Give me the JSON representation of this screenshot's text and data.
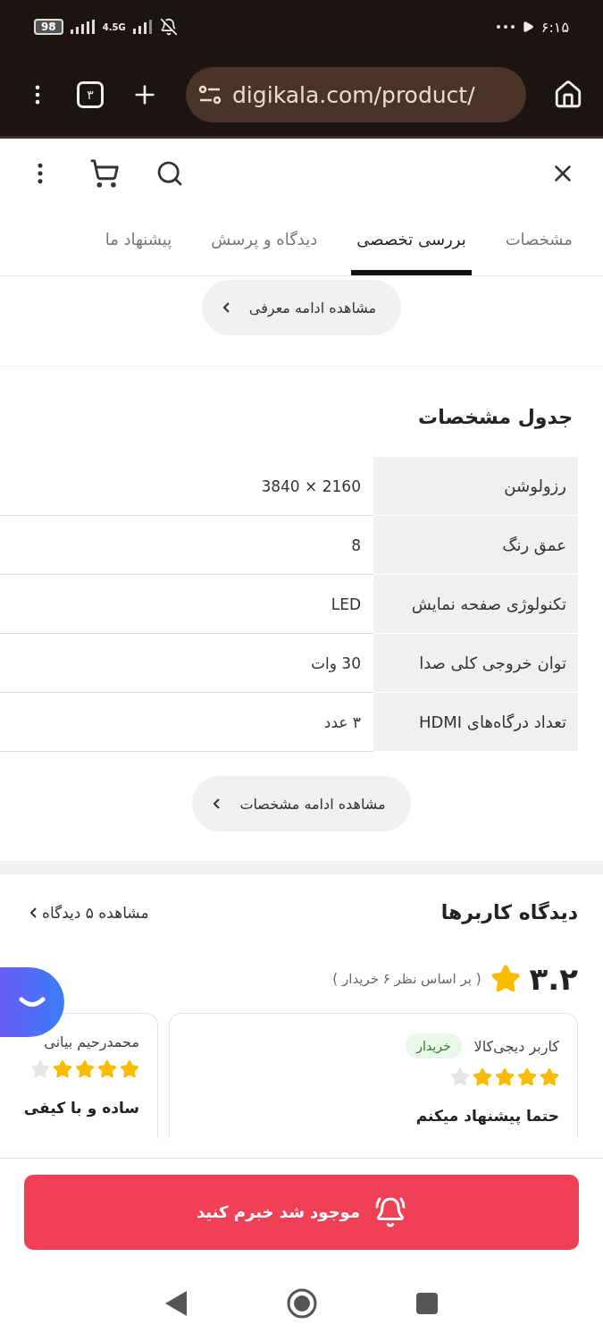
{
  "status_bar": {
    "battery": "98",
    "network": "4.5G",
    "time": "۶:۱۵"
  },
  "browser": {
    "tab_count": "۳",
    "url": "digikala.com/product/"
  },
  "tabs": [
    {
      "label": "مشخصات",
      "selected": false
    },
    {
      "label": "بررسی تخصصی",
      "selected": true
    },
    {
      "label": "دیدگاه و پرسش",
      "selected": false
    },
    {
      "label": "پیشنهاد ما",
      "selected": false
    }
  ],
  "intro_button": "مشاهده ادامه معرفی",
  "specs": {
    "title": "جدول مشخصات",
    "rows": [
      {
        "label": "رزولوشن",
        "value": "3840 × 2160"
      },
      {
        "label": "عمق رنگ",
        "value": "8"
      },
      {
        "label": "تکنولوژی صفحه نمایش",
        "value": "LED"
      },
      {
        "label": "توان خروجی کلی صدا",
        "value": "30 وات"
      },
      {
        "label": "تعداد درگاه‌های HDMI",
        "value": "۳ عدد"
      }
    ],
    "more_button": "مشاهده ادامه مشخصات"
  },
  "reviews": {
    "title": "دیدگاه کاربرها",
    "see_all": "مشاهده ۵ دیدگاه",
    "rating": "۳.۲",
    "based_on": "( بر اساس نظر ۶ خریدار )",
    "items": [
      {
        "author": "کاربر دیجی‌کالا",
        "badge": "خریدار",
        "stars": 4,
        "title": "حتما پیشنهاد میکنم"
      },
      {
        "author": "محمدرحیم بیانی",
        "stars": 4,
        "title": "ساده و با کیفی"
      }
    ]
  },
  "notify_button": "موجود شد خبرم کنید"
}
